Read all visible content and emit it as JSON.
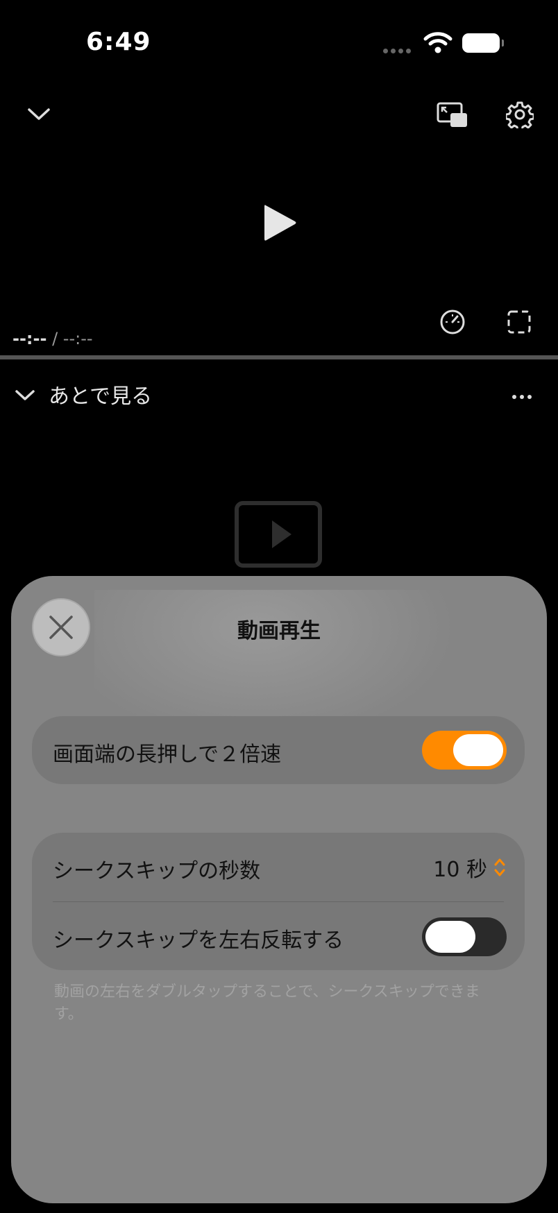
{
  "status_bar": {
    "time": "6:49"
  },
  "player": {
    "current_time": "--:--",
    "separator": " / ",
    "duration": "--:--"
  },
  "playlist": {
    "title": "あとで見る"
  },
  "sheet": {
    "title": "動画再生",
    "long_press_row": {
      "label": "画面端の長押しで２倍速",
      "enabled": true
    },
    "seek_seconds_row": {
      "label": "シークスキップの秒数",
      "value": "10 秒"
    },
    "seek_reverse_row": {
      "label": "シークスキップを左右反転する",
      "enabled": false
    },
    "footnote": "動画の左右をダブルタップすることで、シークスキップできます。"
  },
  "colors": {
    "accent": "#ff8a00",
    "sheet_bg": "#858585",
    "group_bg": "#787878"
  }
}
